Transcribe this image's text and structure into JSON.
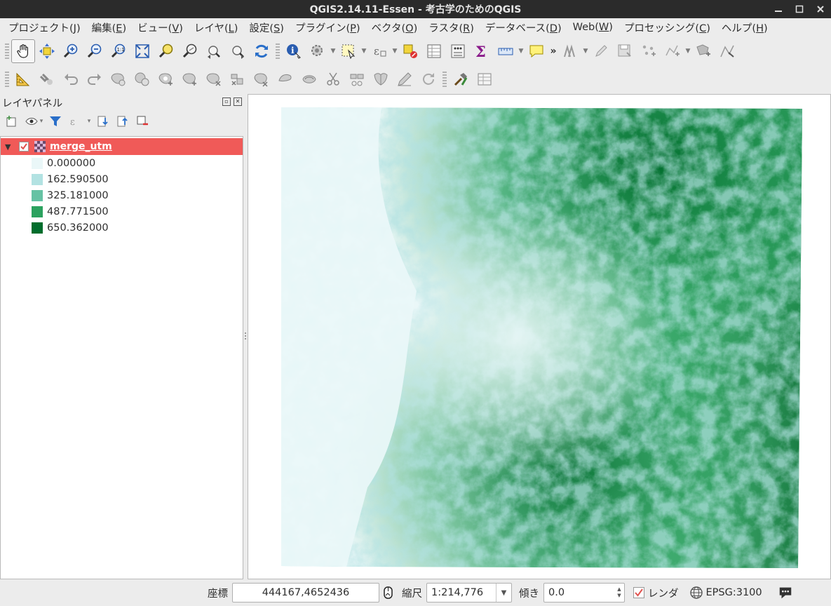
{
  "window": {
    "title": "QGIS2.14.11-Essen - 考古学のためのQGIS"
  },
  "menu": [
    {
      "label": "プロジェクト(",
      "key": "J",
      "tail": ")"
    },
    {
      "label": "編集(",
      "key": "E",
      "tail": ")"
    },
    {
      "label": "ビュー(",
      "key": "V",
      "tail": ")"
    },
    {
      "label": "レイヤ(",
      "key": "L",
      "tail": ")"
    },
    {
      "label": "設定(",
      "key": "S",
      "tail": ")"
    },
    {
      "label": "プラグイン(",
      "key": "P",
      "tail": ")"
    },
    {
      "label": "ベクタ(",
      "key": "O",
      "tail": ")"
    },
    {
      "label": "ラスタ(",
      "key": "R",
      "tail": ")"
    },
    {
      "label": "データベース(",
      "key": "D",
      "tail": ")"
    },
    {
      "label": "Web(",
      "key": "W",
      "tail": ")"
    },
    {
      "label": "プロセッシング(",
      "key": "C",
      "tail": ")"
    },
    {
      "label": "ヘルプ(",
      "key": "H",
      "tail": ")"
    }
  ],
  "toolbar": {
    "overflow": "»"
  },
  "layer_panel": {
    "title": "レイヤパネル",
    "layer": {
      "name": "merge_utm",
      "checked": true
    },
    "legend": [
      {
        "label": "0.000000",
        "color": "#eaf7f8"
      },
      {
        "label": "162.590500",
        "color": "#b2e2e2"
      },
      {
        "label": "325.181000",
        "color": "#66c2a4"
      },
      {
        "label": "487.771500",
        "color": "#2ca25f"
      },
      {
        "label": "650.362000",
        "color": "#006d2c"
      }
    ]
  },
  "statusbar": {
    "coord_label": "座標",
    "coord_value": "444167,4652436",
    "scale_label": "縮尺",
    "scale_value": "1:214,776",
    "rotation_label": "傾き",
    "rotation_value": "0.0",
    "render_label": "レンダ",
    "render_checked": true,
    "crs": "EPSG:3100"
  },
  "colors": {
    "selected_layer": "#f05a58",
    "titlebar": "#2b2b2b"
  }
}
